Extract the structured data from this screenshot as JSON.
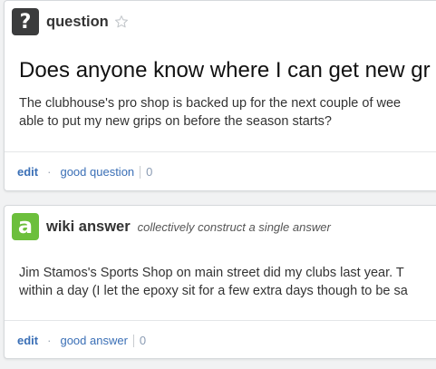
{
  "question_card": {
    "type_label": "question",
    "badge_glyph": "?",
    "title": "Does anyone know where I can get new gr",
    "body_lines": [
      "The clubhouse's pro shop is backed up for the next couple of wee",
      "able to put my new grips on before the season starts?"
    ],
    "actions": {
      "edit": "edit",
      "dot": "·",
      "vote_label": "good question",
      "vote_count": "0"
    }
  },
  "answer_card": {
    "type_label": "wiki answer",
    "badge_glyph": "a",
    "subtitle": "collectively construct a single answer",
    "body_lines": [
      "Jim Stamos's Sports Shop on main street did my clubs last year. T",
      "within a day (I let the epoxy sit for a few extra days though to be sa"
    ],
    "actions": {
      "edit": "edit",
      "dot": "·",
      "vote_label": "good answer",
      "vote_count": "0"
    }
  },
  "colors": {
    "question_badge": "#3b3c3d",
    "answer_badge": "#6cbf3c",
    "link": "#3a6fb6",
    "count": "#8a9bb3"
  },
  "icons": {
    "favorite": "star-icon"
  }
}
